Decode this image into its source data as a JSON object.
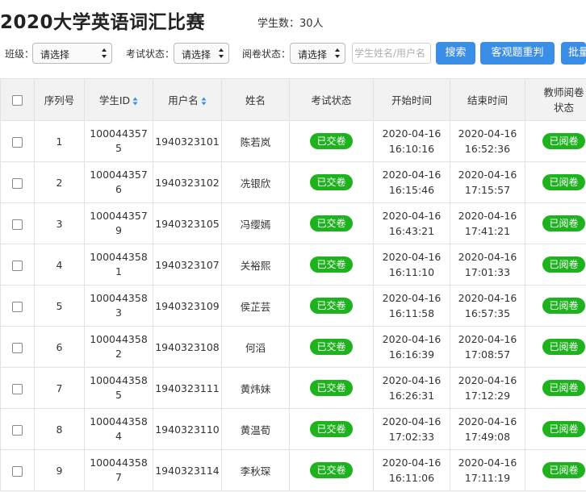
{
  "header": {
    "title": "2020大学英语词汇比赛",
    "student_count": "学生数：30人"
  },
  "filters": {
    "class_label": "班级：",
    "class_value": "请选择",
    "exam_status_label": "考试状态：",
    "exam_status_value": "请选择",
    "review_status_label": "阅卷状态：",
    "review_status_value": "请选择",
    "search_placeholder": "学生姓名/用户名",
    "search_button": "搜索",
    "regrade_button": "客观题重判",
    "batch_button": "批量"
  },
  "colors": {
    "accent": "#3a8ee6",
    "badge_green": "#1fb21f",
    "header_bg": "#f2f2f2"
  },
  "table": {
    "columns": [
      "序列号",
      "学生ID",
      "用户名",
      "姓名",
      "考试状态",
      "开始时间",
      "结束时间",
      "教师阅卷状态"
    ],
    "rows": [
      {
        "seq": "1",
        "sid": "1000443575",
        "user": "1940323101",
        "name": "陈若岚",
        "exam": "已交卷",
        "start_date": "2020-04-16",
        "start_time": "16:10:16",
        "end_date": "2020-04-16",
        "end_time": "16:52:36",
        "review": "已阅卷"
      },
      {
        "seq": "2",
        "sid": "1000443576",
        "user": "1940323102",
        "name": "冼银欣",
        "exam": "已交卷",
        "start_date": "2020-04-16",
        "start_time": "16:15:46",
        "end_date": "2020-04-16",
        "end_time": "17:15:57",
        "review": "已阅卷"
      },
      {
        "seq": "3",
        "sid": "1000443579",
        "user": "1940323105",
        "name": "冯缨嫣",
        "exam": "已交卷",
        "start_date": "2020-04-16",
        "start_time": "16:43:21",
        "end_date": "2020-04-16",
        "end_time": "17:41:21",
        "review": "已阅卷"
      },
      {
        "seq": "4",
        "sid": "1000443581",
        "user": "1940323107",
        "name": "关裕熙",
        "exam": "已交卷",
        "start_date": "2020-04-16",
        "start_time": "16:11:10",
        "end_date": "2020-04-16",
        "end_time": "17:01:33",
        "review": "已阅卷"
      },
      {
        "seq": "5",
        "sid": "1000443583",
        "user": "1940323109",
        "name": "侯芷芸",
        "exam": "已交卷",
        "start_date": "2020-04-16",
        "start_time": "16:11:58",
        "end_date": "2020-04-16",
        "end_time": "16:57:35",
        "review": "已阅卷"
      },
      {
        "seq": "6",
        "sid": "1000443582",
        "user": "1940323108",
        "name": "何滔",
        "exam": "已交卷",
        "start_date": "2020-04-16",
        "start_time": "16:16:39",
        "end_date": "2020-04-16",
        "end_time": "17:08:57",
        "review": "已阅卷"
      },
      {
        "seq": "7",
        "sid": "1000443585",
        "user": "1940323111",
        "name": "黄炜妹",
        "exam": "已交卷",
        "start_date": "2020-04-16",
        "start_time": "16:26:31",
        "end_date": "2020-04-16",
        "end_time": "17:12:29",
        "review": "已阅卷"
      },
      {
        "seq": "8",
        "sid": "1000443584",
        "user": "1940323110",
        "name": "黄温荀",
        "exam": "已交卷",
        "start_date": "2020-04-16",
        "start_time": "17:02:33",
        "end_date": "2020-04-16",
        "end_time": "17:49:08",
        "review": "已阅卷"
      },
      {
        "seq": "9",
        "sid": "1000443587",
        "user": "1940323114",
        "name": "李秋琛",
        "exam": "已交卷",
        "start_date": "2020-04-16",
        "start_time": "16:11:06",
        "end_date": "2020-04-16",
        "end_time": "17:11:19",
        "review": "已阅卷"
      }
    ]
  }
}
